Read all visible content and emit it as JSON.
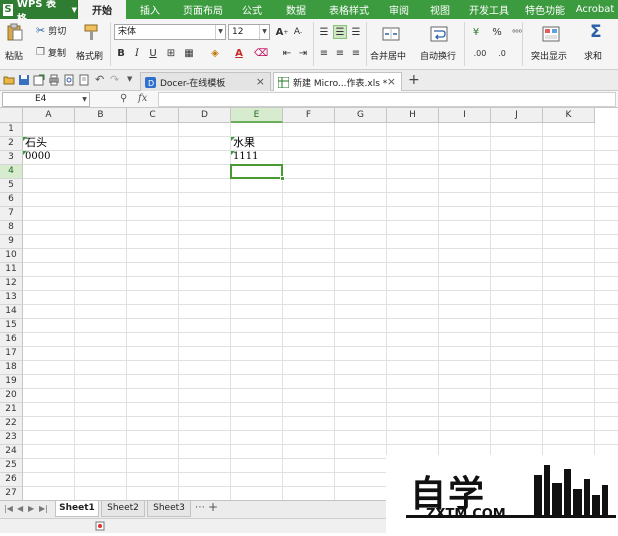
{
  "app": {
    "logo_letter": "S",
    "title": "WPS 表格"
  },
  "menu": {
    "tabs": [
      "开始",
      "插入",
      "页面布局",
      "公式",
      "数据",
      "表格样式",
      "审阅",
      "视图",
      "开发工具",
      "特色功能",
      "Acrobat"
    ],
    "active_index": 0
  },
  "ribbon": {
    "paste": "粘贴",
    "cut": "剪切",
    "copy": "复制",
    "format_painter": "格式刷",
    "font_name": "宋体",
    "font_size": "12",
    "merge_center": "合并居中",
    "wrap_text": "自动换行",
    "highlight": "突出显示",
    "sum": "求和",
    "percent": "%",
    "decimals": ".00",
    "decimals2": ".0"
  },
  "doc_tabs": [
    {
      "label": "Docer-在线模板",
      "active": false
    },
    {
      "label": "新建 Micro...作表.xls *",
      "active": true
    }
  ],
  "formula_bar": {
    "cell_ref": "E4",
    "fx": "fx",
    "content": ""
  },
  "grid": {
    "columns": [
      "A",
      "B",
      "C",
      "D",
      "E",
      "F",
      "G",
      "H",
      "I",
      "J",
      "K"
    ],
    "rows": [
      "1",
      "2",
      "3",
      "4",
      "5",
      "6",
      "7",
      "8",
      "9",
      "10",
      "11",
      "12",
      "13",
      "14",
      "15",
      "16",
      "17",
      "18",
      "19",
      "20",
      "21",
      "22",
      "23",
      "24",
      "25",
      "26",
      "27"
    ],
    "selected_column": "E",
    "selected_row": "4",
    "cells": {
      "A2": "石头",
      "A3": "0000",
      "E2": "水果",
      "E3": "1111"
    }
  },
  "sheets": {
    "tabs": [
      "Sheet1",
      "Sheet2",
      "Sheet3"
    ],
    "active_index": 0,
    "more": "⋯",
    "add": "+"
  },
  "watermark": {
    "text_cn": "自学",
    "text_url": "ZXTM.COM"
  }
}
